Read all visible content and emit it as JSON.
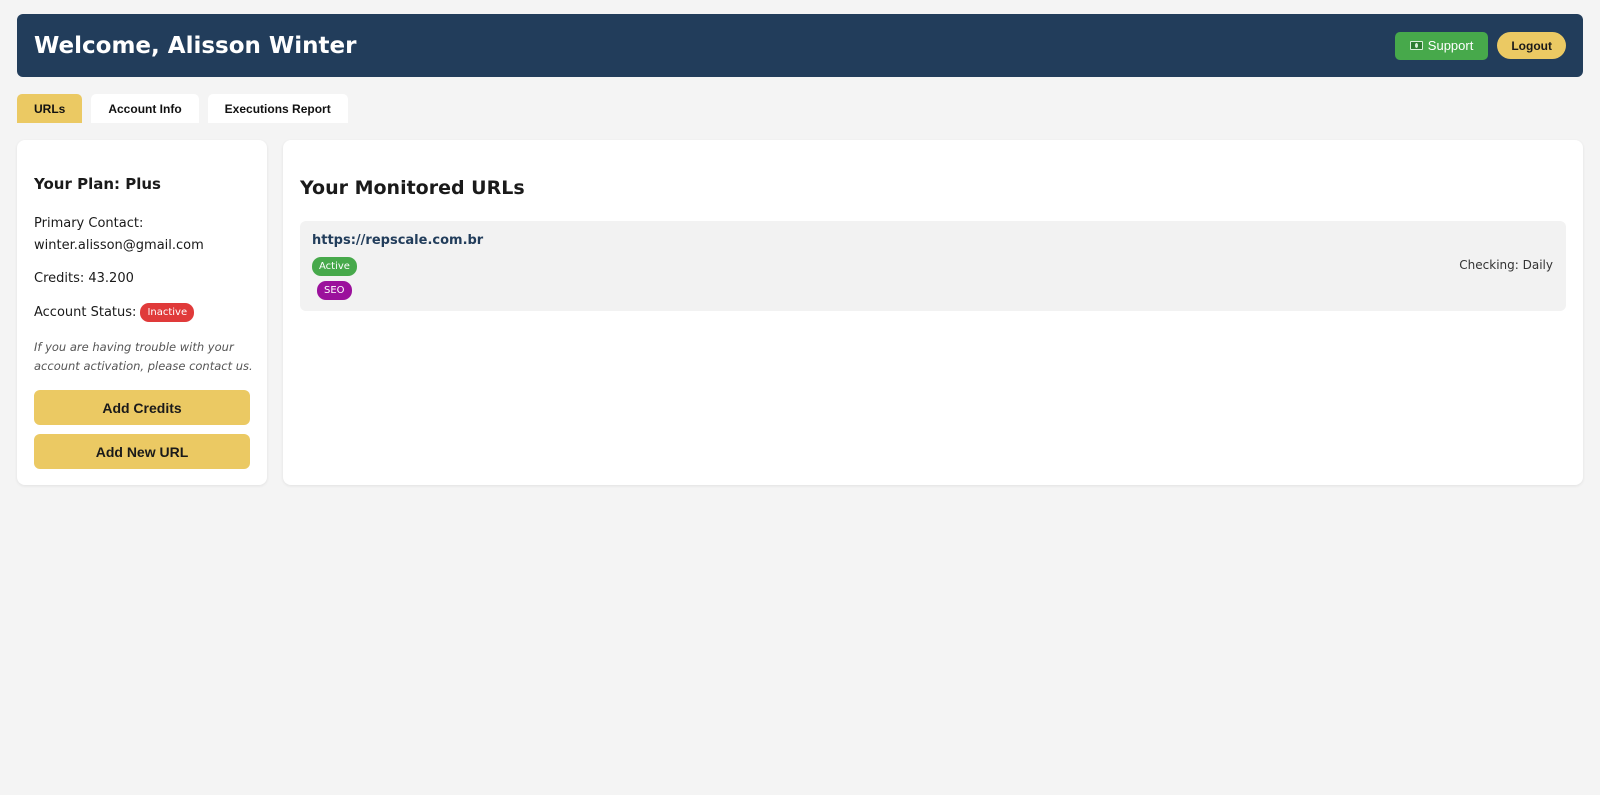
{
  "header": {
    "title": "Welcome, Alisson Winter",
    "support_label": "Support",
    "logout_label": "Logout",
    "colors": {
      "background": "#223d5b",
      "support": "#47a94b",
      "logout": "#ebc963"
    }
  },
  "tabs": [
    {
      "label": "URLs",
      "active": true
    },
    {
      "label": "Account Info",
      "active": false
    },
    {
      "label": "Executions Report",
      "active": false
    }
  ],
  "account": {
    "plan": "Your Plan: Plus",
    "contact_label": "Primary Contact:",
    "contact_email": "winter.alisson@gmail.com",
    "credits": "Credits: 43.200",
    "status_label": "Account Status:",
    "status_badge": "Inactive",
    "help_text": "If you are having trouble with your account activation, please contact us.",
    "add_credits_label": "Add Credits",
    "add_url_label": "Add New URL"
  },
  "monitored": {
    "title": "Your Monitored URLs",
    "urls": [
      {
        "url": "https://repscale.com.br",
        "status": "Active",
        "tag": "SEO",
        "checking": "Checking: Daily"
      }
    ]
  },
  "icons": {
    "support": "money-icon"
  }
}
